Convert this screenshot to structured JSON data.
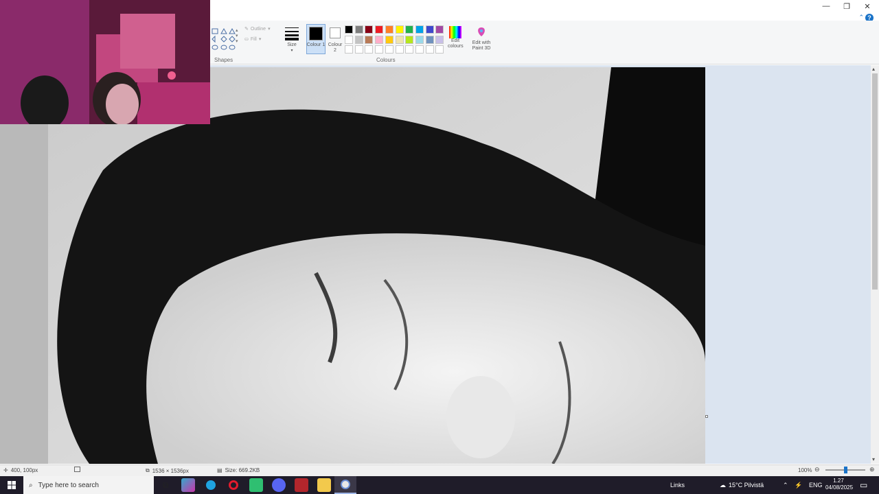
{
  "titlebar": {
    "minimize_label": "—",
    "restore_label": "❐",
    "close_label": "✕",
    "help_label": "?",
    "collapse_label": "⌃"
  },
  "ribbon": {
    "shapes_group_label": "Shapes",
    "outline_label": "Outline",
    "fill_label": "Fill",
    "size_label": "Size",
    "colour1_label": "Colour 1",
    "colour2_label": "Colour 2",
    "colours_group_label": "Colours",
    "edit_colours_label": "Edit colours",
    "edit_paint3d_label": "Edit with Paint 3D",
    "palette_row1": [
      "#000000",
      "#7f7f7f",
      "#880015",
      "#ed1c24",
      "#ff7f27",
      "#fff200",
      "#22b14c",
      "#00a2e8",
      "#3f48cc",
      "#a349a4"
    ],
    "palette_row2": [
      "#ffffff",
      "#c3c3c3",
      "#b97a57",
      "#ffaec9",
      "#ffc90e",
      "#efe4b0",
      "#b5e61d",
      "#99d9ea",
      "#7092be",
      "#c8bfe7"
    ],
    "palette_row3": [
      "#ffffff",
      "#ffffff",
      "#ffffff",
      "#ffffff",
      "#ffffff",
      "#ffffff",
      "#ffffff",
      "#ffffff",
      "#ffffff",
      "#ffffff"
    ]
  },
  "statusbar": {
    "cursor_pos": "400, 100px",
    "dimensions": "1536 × 1536px",
    "file_size": "Size: 669.2KB",
    "zoom_level": "100%",
    "zoom_fraction": 0.5
  },
  "taskbar": {
    "search_placeholder": "Type here to search",
    "links_label": "Links",
    "weather_text": "15°C  Pilvistä",
    "language": "ENG",
    "time": "1.27",
    "date": "04/08/2025"
  },
  "colors": {
    "taskbar_bg": "#1f1c29",
    "ribbon_bg": "#f5f6f7",
    "workspace_bg": "#dbe4f0",
    "accent": "#1a73c8"
  }
}
